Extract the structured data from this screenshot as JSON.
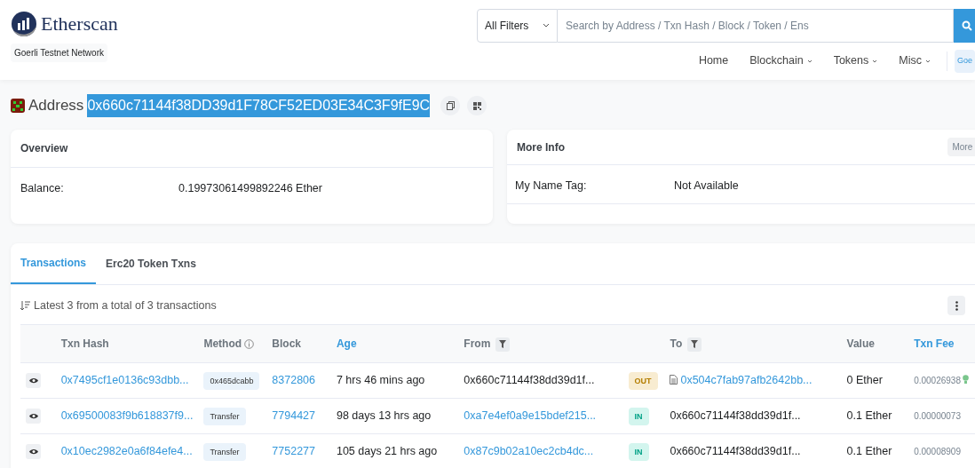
{
  "brand": {
    "name": "Etherscan",
    "network": "Goerli Testnet Network"
  },
  "search": {
    "filter": "All Filters",
    "placeholder": "Search by Address / Txn Hash / Block / Token / Ens"
  },
  "nav": [
    {
      "label": "Home",
      "dropdown": false
    },
    {
      "label": "Blockchain",
      "dropdown": true
    },
    {
      "label": "Tokens",
      "dropdown": true
    },
    {
      "label": "Misc",
      "dropdown": true
    }
  ],
  "network_badge": "Goe",
  "address": {
    "label": "Address",
    "value": "0x660c71144f38DD39d1F78CF52ED03E34C3F9fE9C",
    "selected": true
  },
  "overview": {
    "title": "Overview",
    "rows": [
      {
        "label": "Balance:",
        "value": "0.19973061499892246 Ether"
      }
    ]
  },
  "more_info": {
    "title": "More Info",
    "button": "More",
    "rows": [
      {
        "label": "My Name Tag:",
        "value": "Not Available"
      }
    ]
  },
  "tabs": [
    {
      "label": "Transactions",
      "selected": true
    },
    {
      "label": "Erc20 Token Txns",
      "selected": false
    }
  ],
  "summary": "Latest 3 from a total of 3 transactions",
  "table": {
    "columns": [
      {
        "label": "Txn Hash",
        "link": false,
        "info": false,
        "filter": false
      },
      {
        "label": "Method",
        "link": false,
        "info": true,
        "filter": false
      },
      {
        "label": "Block",
        "link": false,
        "info": false,
        "filter": false
      },
      {
        "label": "Age",
        "link": true,
        "info": false,
        "filter": false
      },
      {
        "label": "From",
        "link": false,
        "info": false,
        "filter": true
      },
      {
        "label": "To",
        "link": false,
        "info": false,
        "filter": true
      },
      {
        "label": "Value",
        "link": false,
        "info": false,
        "filter": false
      },
      {
        "label": "Txn Fee",
        "link": true,
        "info": false,
        "filter": false
      }
    ],
    "rows": [
      {
        "hash": "0x7495cf1e0136c93dbb...",
        "method": "0x465dcabb",
        "block": "8372806",
        "age": "7 hrs 46 mins ago",
        "from": "0x660c71144f38dd39d1f...",
        "from_link": false,
        "direction": "OUT",
        "to": "0x504c7fab97afb2642bb...",
        "to_link": true,
        "to_contract": true,
        "value": "0 Ether",
        "fee": "0.00026938",
        "gas_icon": true
      },
      {
        "hash": "0x69500083f9b618837f9...",
        "method": "Transfer",
        "block": "7794427",
        "age": "98 days 13 hrs ago",
        "from": "0xa7e4ef0a9e15bdef215...",
        "from_link": true,
        "direction": "IN",
        "to": "0x660c71144f38dd39d1f...",
        "to_link": false,
        "to_contract": false,
        "value": "0.1 Ether",
        "fee": "0.00000073",
        "gas_icon": false
      },
      {
        "hash": "0x10ec2982e0a6f84efe4...",
        "method": "Transfer",
        "block": "7752277",
        "age": "105 days 21 hrs ago",
        "from": "0x87c9b02a10ec2cb4dc...",
        "from_link": true,
        "direction": "IN",
        "to": "0x660c71144f38dd39d1f...",
        "to_link": false,
        "to_contract": false,
        "value": "0.1 Ether",
        "fee": "0.00008909",
        "gas_icon": false
      }
    ]
  }
}
